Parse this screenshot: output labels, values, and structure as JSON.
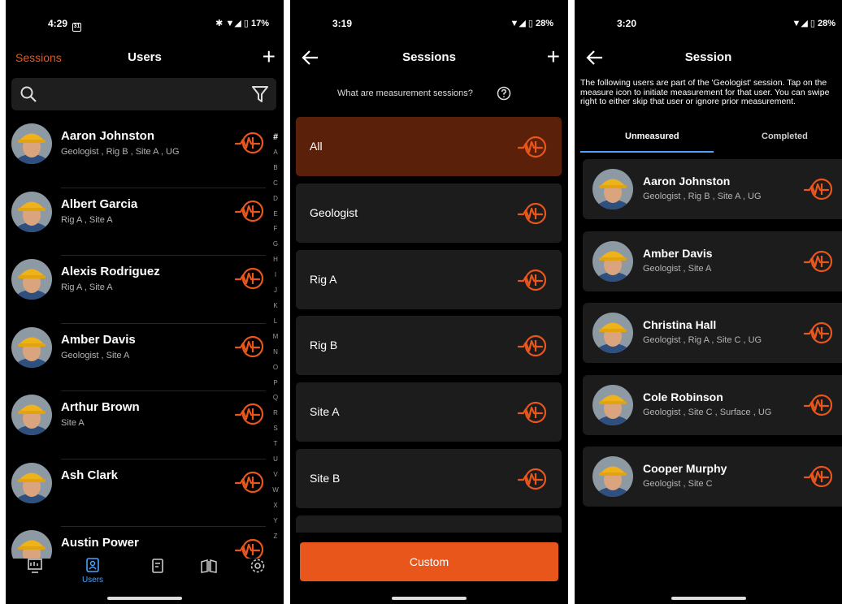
{
  "accent": "#e9561c",
  "tab_accent": "#4aa3ff",
  "users_screen": {
    "status": {
      "time": "4:29",
      "calendar_day": "31",
      "icons": "✱ ▼◢ ▯",
      "battery": "17%"
    },
    "header": {
      "left_link": "Sessions",
      "title": "Users",
      "add": "+"
    },
    "search": {
      "placeholder": "",
      "search_icon": "search-icon",
      "filter_icon": "filter-icon"
    },
    "users": [
      {
        "name": "Aaron Johnston",
        "tags": "Geologist , Rig B , Site A , UG"
      },
      {
        "name": "Albert Garcia",
        "tags": "Rig A , Site A"
      },
      {
        "name": "Alexis Rodriguez",
        "tags": "Rig A , Site A"
      },
      {
        "name": "Amber Davis",
        "tags": "Geologist , Site A"
      },
      {
        "name": "Arthur Brown",
        "tags": "Site A"
      },
      {
        "name": "Ash Clark",
        "tags": ""
      },
      {
        "name": "Austin Power",
        "tags": ""
      }
    ],
    "alphabet": [
      "#",
      "A",
      "B",
      "C",
      "D",
      "E",
      "F",
      "G",
      "H",
      "I",
      "J",
      "K",
      "L",
      "M",
      "N",
      "O",
      "P",
      "Q",
      "R",
      "S",
      "T",
      "U",
      "V",
      "W",
      "X",
      "Y",
      "Z"
    ],
    "nav": {
      "users_label": "Users"
    }
  },
  "sessions_screen": {
    "status": {
      "time": "3:19",
      "icons": "▼◢ ▯",
      "battery": "28%"
    },
    "header": {
      "title": "Sessions",
      "add": "+"
    },
    "info": {
      "text": "What are measurement sessions?",
      "help_icon": "help-circle-icon"
    },
    "sessions": [
      {
        "label": "All",
        "active": true
      },
      {
        "label": "Geologist",
        "active": false
      },
      {
        "label": "Rig A",
        "active": false
      },
      {
        "label": "Rig B",
        "active": false
      },
      {
        "label": "Site A",
        "active": false
      },
      {
        "label": "Site B",
        "active": false
      },
      {
        "label": "",
        "active": false
      }
    ],
    "custom_button": "Custom"
  },
  "session_screen": {
    "status": {
      "time": "3:20",
      "icons": "▼◢ ▯",
      "battery": "28%"
    },
    "header": {
      "title": "Session"
    },
    "description": "The following users are part of the 'Geologist' session. Tap on the measure icon to initiate measurement for that user. You can swipe right to either skip that user or ignore prior measurement.",
    "tabs": {
      "unmeasured": "Unmeasured",
      "completed": "Completed"
    },
    "members": [
      {
        "name": "Aaron Johnston",
        "tags": "Geologist , Rig B , Site A , UG"
      },
      {
        "name": "Amber Davis",
        "tags": "Geologist , Site A"
      },
      {
        "name": "Christina Hall",
        "tags": "Geologist , Rig A , Site C , UG"
      },
      {
        "name": "Cole Robinson",
        "tags": "Geologist , Site C , Surface , UG"
      },
      {
        "name": "Cooper Murphy",
        "tags": "Geologist , Site C"
      }
    ]
  }
}
